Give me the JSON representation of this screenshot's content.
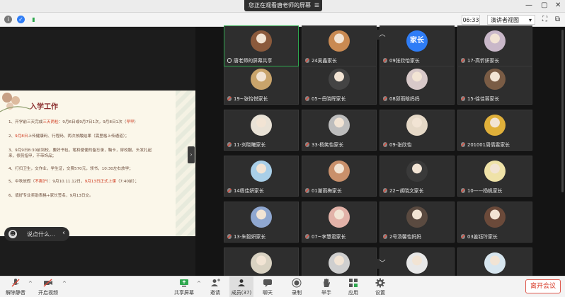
{
  "topbar": {
    "share_banner": "您正在观看唐老师的屏幕",
    "menu_icon": "menu-icon",
    "window_controls": [
      "—",
      "▢",
      "✕"
    ]
  },
  "toolbar": {
    "timer": "06:33",
    "view_mode": "演讲者视图"
  },
  "slide": {
    "title": "入学工作",
    "lines": [
      {
        "a": "1、开学前三天完成",
        "b": "三天两检",
        "c": "：9月6日或9月7日1次，9月8日1次（",
        "d": "早早",
        "e": "）"
      },
      {
        "a": "2、",
        "b": "9月8日",
        "c": "上传健康码、行程码、两次核酸结果（需里格上传通道）；",
        "d": "",
        "e": ""
      },
      {
        "a": "3、9月9日8:30前到校，要好书包，笔和便便的备忘录，鞠卡，穿校服，头发扎起",
        "b": "",
        "c": "",
        "d": "",
        "e": ""
      },
      {
        "a": "   来，修剪指甲，不带饰品；",
        "b": "",
        "c": "",
        "d": "",
        "e": ""
      },
      {
        "a": "4、打扫卫生，交作业，学生证，交费570元，领书，10:30左右放学；",
        "b": "",
        "c": "",
        "d": "",
        "e": ""
      },
      {
        "a": "5、中秋放假（",
        "b": "不离沪",
        "c": "）：9月10.11.12日，",
        "d": "9月13日正式上课",
        "e": "（7:40前）；"
      },
      {
        "a": "6、填好专业奖助表格+家长签名，9月13日交。",
        "b": "",
        "c": "",
        "d": "",
        "e": ""
      }
    ]
  },
  "chat": {
    "placeholder": "说点什么..."
  },
  "participants": [
    {
      "name": "唐老师的屏幕共享",
      "avatar": "photo",
      "color": "#8b5a3c",
      "mic": "on",
      "active": true
    },
    {
      "name": "24吴鑫家长",
      "avatar": "photo",
      "color": "#c98a52",
      "mic": "off"
    },
    {
      "name": "09张欣怡家长",
      "avatar": "家长",
      "color": "#2f7df6",
      "mic": "off"
    },
    {
      "name": "17-高忻妍家长",
      "avatar": "photo",
      "color": "#c9b8c9",
      "mic": "off"
    },
    {
      "name": "19~张怡悦家长",
      "avatar": "photo",
      "color": "#c9a46b",
      "mic": "off"
    },
    {
      "name": "05~岳晓晖家长",
      "avatar": "photo",
      "color": "#444444",
      "mic": "off"
    },
    {
      "name": "08邱雨晗妈妈",
      "avatar": "photo",
      "color": "#d8c9c9",
      "mic": "off"
    },
    {
      "name": "15-徐佳蓉家长",
      "avatar": "photo",
      "color": "#7a5c45",
      "mic": "off"
    },
    {
      "name": "11-刘晓曦家长",
      "avatar": "photo",
      "color": "#e9e2d6",
      "mic": "off"
    },
    {
      "name": "33-杨笑怡家长",
      "avatar": "photo",
      "color": "#bdbdbd",
      "mic": "off"
    },
    {
      "name": "09-张欣怡",
      "avatar": "photo",
      "color": "#e6d9c7",
      "mic": "off"
    },
    {
      "name": "201001周倩雯家长",
      "avatar": "photo",
      "color": "#e0b03a",
      "mic": "off"
    },
    {
      "name": "14杨佳妍家长",
      "avatar": "photo",
      "color": "#a9cfe8",
      "mic": "off"
    },
    {
      "name": "01谢雨梅家长",
      "avatar": "photo",
      "color": "#c9906b",
      "mic": "off"
    },
    {
      "name": "22~胡晓文家长",
      "avatar": "photo",
      "color": "#3a3a3a",
      "mic": "off"
    },
    {
      "name": "10——杨帆家长",
      "avatar": "photo",
      "color": "#efe2a8",
      "mic": "off"
    },
    {
      "name": "13-朱毅妍家长",
      "avatar": "photo",
      "color": "#8fa7d0",
      "mic": "off"
    },
    {
      "name": "07~李慧君家长",
      "avatar": "photo",
      "color": "#e2b2a8",
      "mic": "off"
    },
    {
      "name": "2号汤馨怡妈妈",
      "avatar": "photo",
      "color": "#5a4a40",
      "mic": "off"
    },
    {
      "name": "03姜钰玲家长",
      "avatar": "photo",
      "color": "#6b4a3a",
      "mic": "off"
    },
    {
      "name": "",
      "avatar": "photo",
      "color": "#d9d2c2",
      "mic": "off"
    },
    {
      "name": "",
      "avatar": "photo",
      "color": "#cfcfcf",
      "mic": "off"
    },
    {
      "name": "",
      "avatar": "photo",
      "color": "#e8e8e8",
      "mic": "off"
    },
    {
      "name": "",
      "avatar": "photo",
      "color": "#d7e6ef",
      "mic": "off"
    }
  ],
  "bottombar": {
    "mute": "解除静音",
    "video": "开启视频",
    "share": "共享屏幕",
    "invite": "邀请",
    "members": "成员(37)",
    "chat": "聊天",
    "record": "录制",
    "raise_hand": "举手",
    "apps": "应用",
    "settings": "设置",
    "leave": "离开会议"
  },
  "colors": {
    "accent_green": "#2fa84f",
    "leave_red": "#d9412f",
    "avatar_blue": "#2f7df6"
  }
}
